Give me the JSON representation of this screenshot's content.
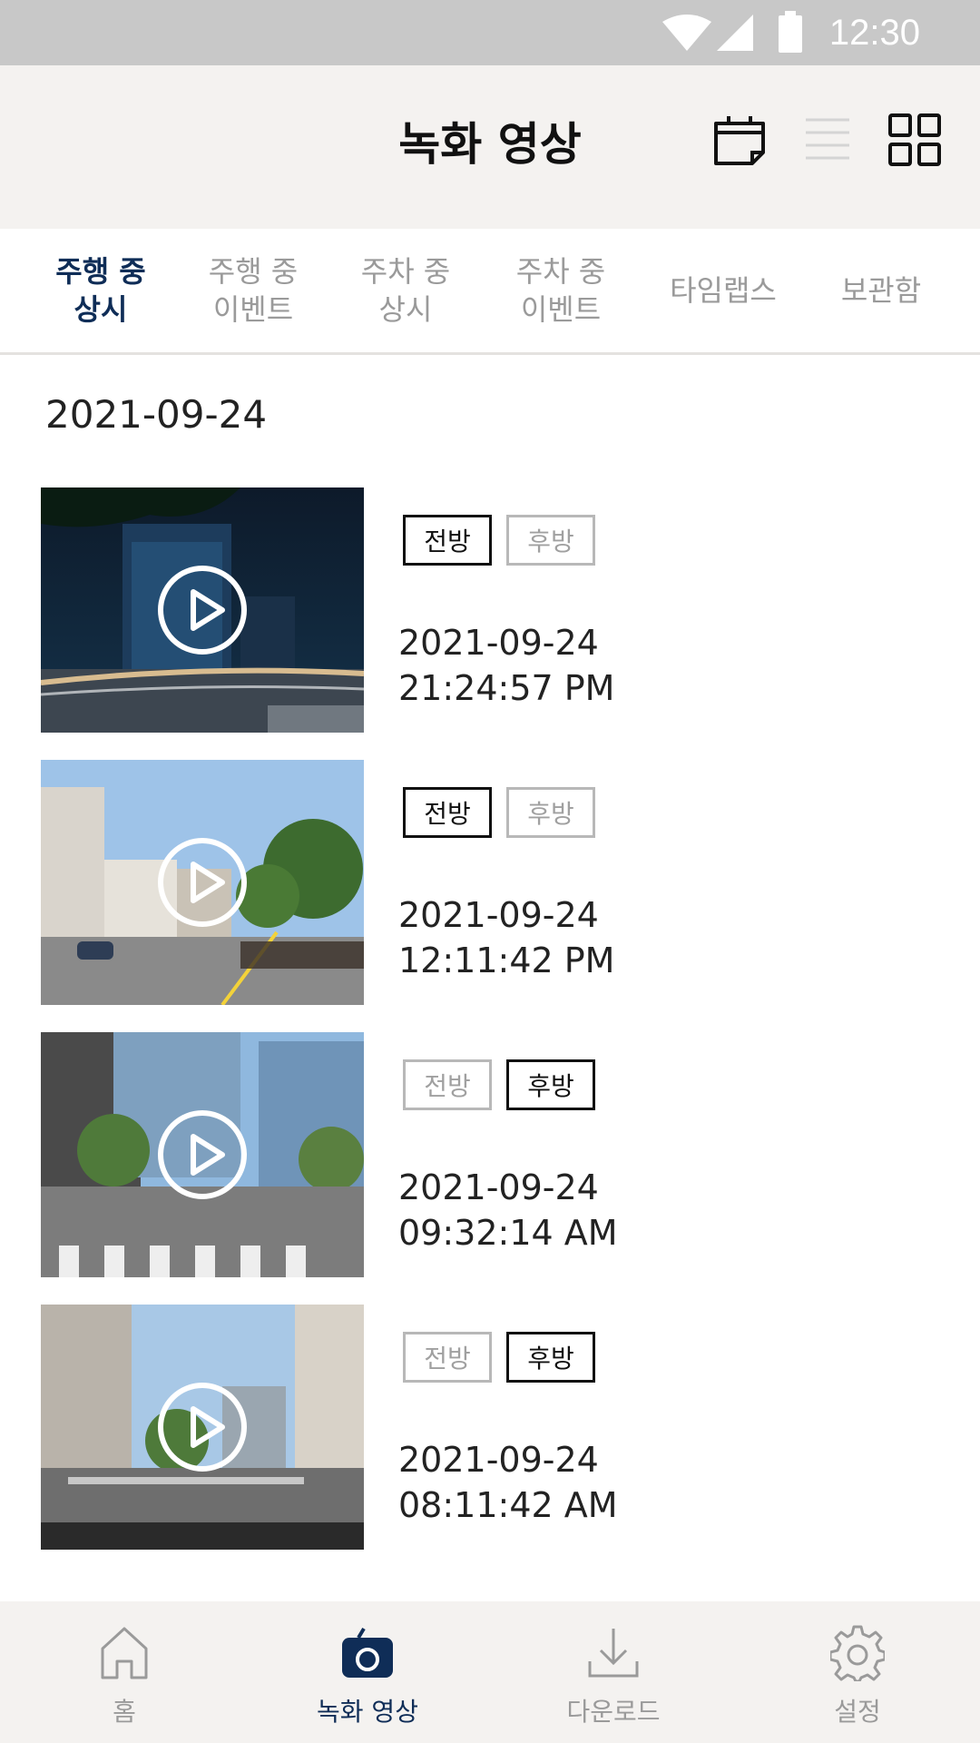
{
  "status_bar": {
    "time": "12:30",
    "icons": [
      "wifi-icon",
      "signal-icon",
      "battery-icon"
    ]
  },
  "header": {
    "title": "녹화 영상",
    "icons": [
      "calendar-icon",
      "list-view-icon",
      "grid-view-icon"
    ]
  },
  "tabs": [
    {
      "label": "주행 중\n상시",
      "active": true
    },
    {
      "label": "주행 중\n이벤트",
      "active": false
    },
    {
      "label": "주차 중\n상시",
      "active": false
    },
    {
      "label": "주차 중\n이벤트",
      "active": false
    },
    {
      "label": "타임랩스",
      "active": false
    },
    {
      "label": "보관함",
      "active": false
    }
  ],
  "date_header": "2021-09-24",
  "videos": [
    {
      "front": "전방",
      "rear": "후방",
      "selected": "front",
      "date": "2021-09-24",
      "time": "21:24:57 PM"
    },
    {
      "front": "전방",
      "rear": "후방",
      "selected": "front",
      "date": "2021-09-24",
      "time": "12:11:42 PM"
    },
    {
      "front": "전방",
      "rear": "후방",
      "selected": "rear",
      "date": "2021-09-24",
      "time": "09:32:14 AM"
    },
    {
      "front": "전방",
      "rear": "후방",
      "selected": "rear",
      "date": "2021-09-24",
      "time": "08:11:42 AM"
    }
  ],
  "bottom_nav": [
    {
      "label": "홈",
      "icon": "home-icon",
      "active": false
    },
    {
      "label": "녹화 영상",
      "icon": "dashcam-icon",
      "active": true
    },
    {
      "label": "다운로드",
      "icon": "download-icon",
      "active": false
    },
    {
      "label": "설정",
      "icon": "settings-gear-icon",
      "active": false
    }
  ],
  "colors": {
    "accent": "#0f2d57",
    "inactive": "#9a9a9a",
    "bar_bg": "#f4f2f0",
    "status_bg": "#c8c8c8"
  }
}
